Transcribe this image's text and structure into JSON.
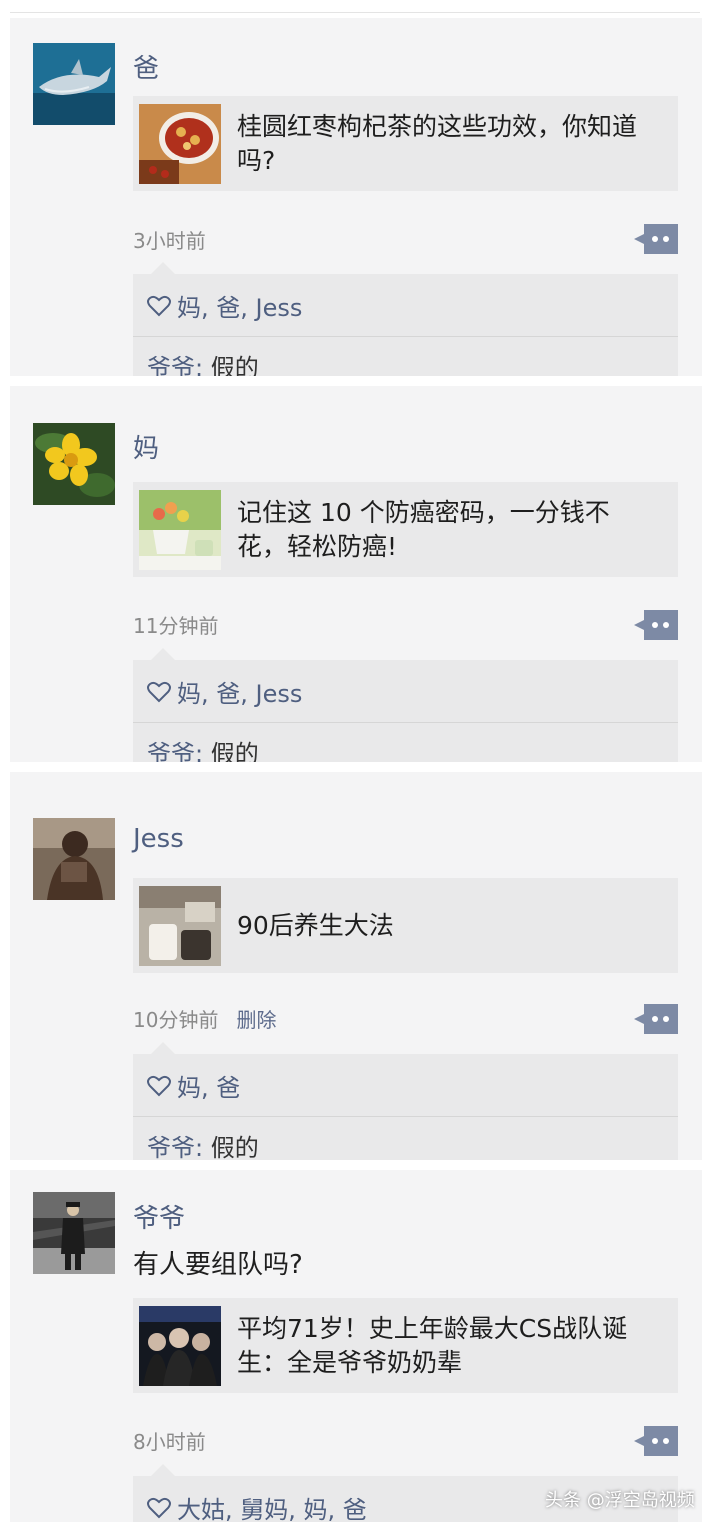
{
  "posts": [
    {
      "name": "爸",
      "card_title": "桂圆红枣枸杞茶的这些功效，你知道吗?",
      "time": "3小时前",
      "likes": "妈, 爸, Jess",
      "comment_author": "爷爷:",
      "comment_text": "假的",
      "avatar_icon": "shark-photo",
      "thumb_icon": "tea-cup-photo"
    },
    {
      "name": "妈",
      "card_title": "记住这 10 个防癌密码，一分钱不花，轻松防癌!",
      "time": "11分钟前",
      "likes": "妈, 爸, Jess",
      "comment_author": "爷爷:",
      "comment_text": "假的",
      "avatar_icon": "yellow-flower-photo",
      "thumb_icon": "flower-pot-photo"
    },
    {
      "name": "Jess",
      "card_title": "90后养生大法",
      "time": "10分钟前",
      "delete_label": "删除",
      "likes": "妈, 爸",
      "comment_author": "爷爷:",
      "comment_text": "假的",
      "avatar_icon": "person-photo",
      "thumb_icon": "cups-photo"
    },
    {
      "name": "爷爷",
      "post_text": "有人要组队吗?",
      "card_title": "平均71岁！史上年龄最大CS战队诞生：全是爷爷奶奶辈",
      "time": "8小时前",
      "likes": "大姑, 舅妈, 妈, 爸",
      "avatar_icon": "man-on-platform-photo",
      "thumb_icon": "elderly-team-photo"
    }
  ],
  "watermark": "头条 @浮空岛视频",
  "colors": {
    "name": "#4f5f80",
    "panel": "#f4f4f5",
    "card": "#e9e9ea",
    "meta": "#8a8a8a",
    "bubble": "#7d8aa5"
  }
}
